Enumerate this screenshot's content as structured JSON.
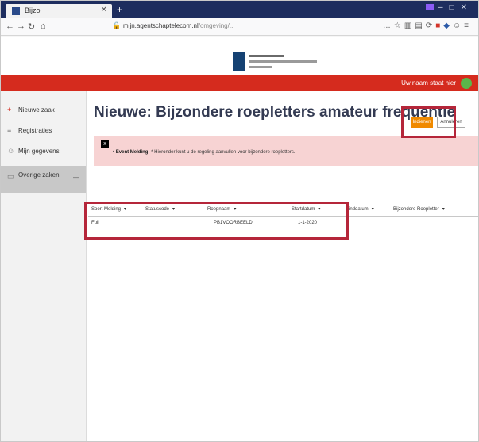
{
  "browser": {
    "tab_title": "Bijzo",
    "url_host": "mijn.agentschaptelecom.nl",
    "url_rest": "/omgeving/..."
  },
  "site": {
    "logo_lines": [
      "Agentschap Telecom",
      "Ministerie van Economische Zaken",
      "en Klimaat"
    ],
    "user_link": "Uw naam staat hier"
  },
  "sidebar": {
    "items": [
      {
        "label": "Nieuwe zaak",
        "icon": "plus-icon"
      },
      {
        "label": "Registraties",
        "icon": "list-icon"
      },
      {
        "label": "Mijn gegevens",
        "icon": "user-icon"
      },
      {
        "label": "Overige zaken",
        "icon": "folder-icon"
      }
    ]
  },
  "main": {
    "title": "Nieuwe: Bijzondere roepletters amateur frequentie",
    "save_label": "Indienen",
    "cancel_label": "Annuleren",
    "alert_close": "x",
    "alert_label": "Event Melding:",
    "alert_text": "Hieronder kunt u de regeling aanvullen voor bijzondere roepletters."
  },
  "table": {
    "columns": [
      "Soort Melding",
      "Statuscode",
      "Roepnaam",
      "Startdatum",
      "Einddatum",
      "Bijzondere Roepletter"
    ],
    "rows": [
      [
        "Full",
        "",
        "PB1VOORBEELD",
        "1-1-2020",
        "",
        ""
      ]
    ]
  }
}
